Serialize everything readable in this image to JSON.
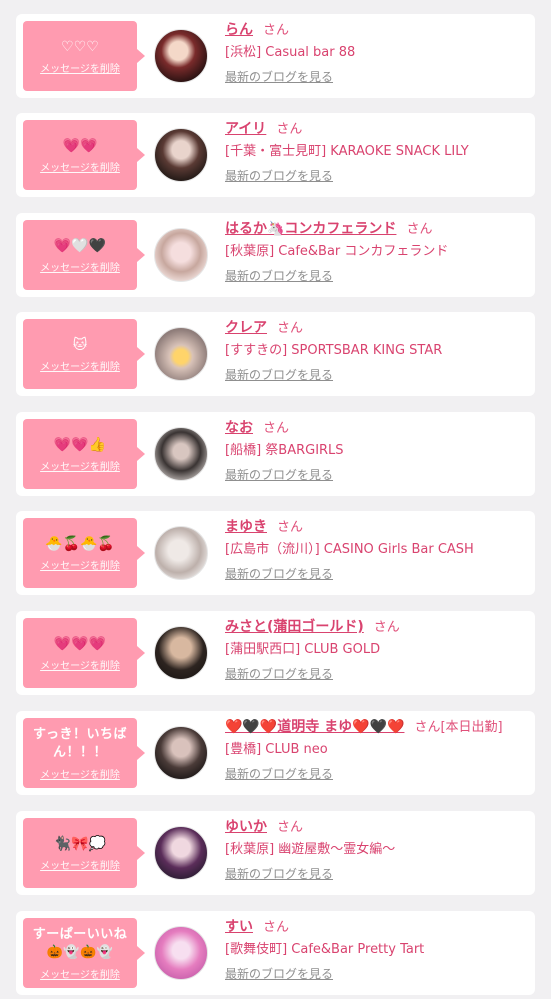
{
  "delete_label": "メッセージを削除",
  "san_label": "さん",
  "blog_label": "最新のブログを見る",
  "colors": {
    "accent": "#d9436f",
    "bubble": "#ff9bb0",
    "background": "#f1f0f2"
  },
  "entries": [
    {
      "message": "♡♡♡",
      "name": "らん",
      "suffix": "",
      "shop": "[浜松] Casual bar 88",
      "emoji": true
    },
    {
      "message": "💗💗",
      "name": "アイリ",
      "suffix": "",
      "shop": "[千葉・富士見町] KARAOKE SNACK LILY",
      "emoji": true
    },
    {
      "message": "💗🤍🖤",
      "name": "はるか🦄コンカフェランド",
      "suffix": "",
      "shop": "[秋葉原] Cafe&Bar コンカフェランド",
      "emoji": true
    },
    {
      "message": "🐱",
      "name": "クレア",
      "suffix": "",
      "shop": "[すすきの] SPORTSBAR KING STAR",
      "emoji": true
    },
    {
      "message": "💗💗👍",
      "name": "なお",
      "suffix": "",
      "shop": "[船橋] 祭BARGIRLS",
      "emoji": true
    },
    {
      "message": "🐣🍒🐣🍒",
      "name": "まゆき",
      "suffix": "",
      "shop": "[広島市（流川）] CASINO Girls Bar CASH",
      "emoji": true
    },
    {
      "message": "💗💗💗",
      "name": "みさと(蒲田ゴールド)",
      "suffix": "",
      "shop": "[蒲田駅西口] CLUB GOLD",
      "emoji": true
    },
    {
      "message": "すっき！いちばん！！！",
      "name": "❤️🖤❤️道明寺 まゆ❤️🖤❤️",
      "suffix": "[本日出勤]",
      "shop": "[豊橋] CLUB neo",
      "emoji": false
    },
    {
      "message": "🐈‍⬛🎀💭",
      "name": "ゆいか",
      "suffix": "",
      "shop": "[秋葉原] 幽遊屋敷〜霊女編〜",
      "emoji": true
    },
    {
      "message": "すーぱーいいね🎃👻🎃👻",
      "name": "すい",
      "suffix": "",
      "shop": "[歌舞伎町] Cafe&Bar Pretty Tart",
      "emoji": false
    }
  ]
}
